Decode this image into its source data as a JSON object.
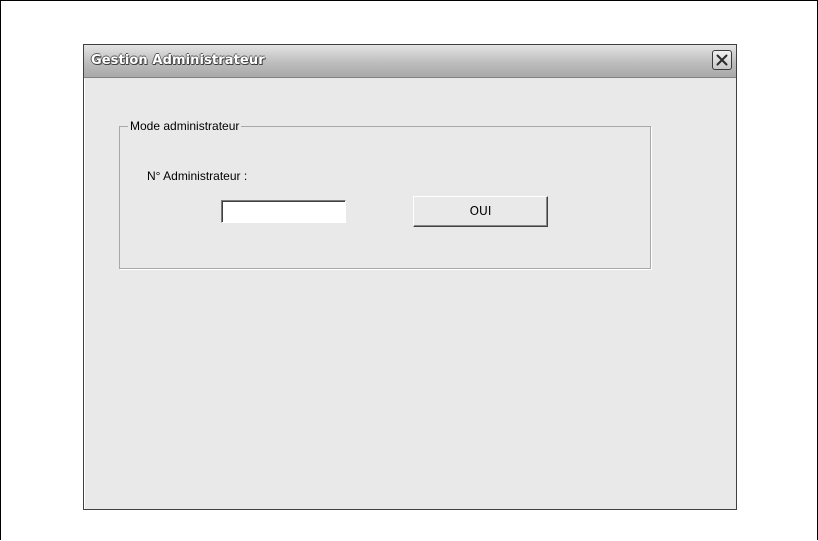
{
  "window": {
    "title": "Gestion Administrateur",
    "close_icon": "close-icon"
  },
  "group": {
    "legend": "Mode administrateur",
    "admin_label": "N° Administrateur :",
    "admin_input": {
      "value": "",
      "placeholder": ""
    },
    "ok_button_label": "OUI"
  },
  "colors": {
    "window_background": "#e9e9e9",
    "titlebar_gradient_top": "#e4e4e4",
    "titlebar_gradient_bottom": "#a9a9a9",
    "title_text": "#ffffff"
  }
}
